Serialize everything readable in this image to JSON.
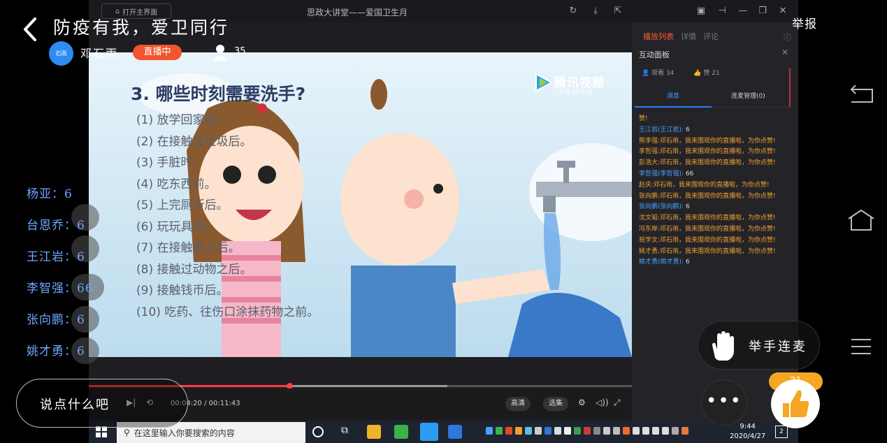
{
  "pc_window": {
    "open_main_label": "打开主界面",
    "title": "思政大讲堂——爱国卫生月"
  },
  "video": {
    "heading": "3. 哪些时刻需要洗手?",
    "list": [
      "(1)  放学回家后。",
      "(2)  在接触过垃圾后。",
      "(3)  手脏时。",
      "(4)  吃东西前。",
      "(5)  上完厕所后。",
      "(6)  玩玩具后。",
      "(7)  在接触他人后。",
      "(8)  接触过动物之后。",
      "(9)  接触钱币后。",
      "(10)  吃药、往伤口涂抹药物之前。"
    ],
    "logo_text": "腾讯视频",
    "logo_sub": "不负好时光"
  },
  "player": {
    "time": "00:04:20 / 00:11:43",
    "progress": 0.37,
    "buffered": 0.66,
    "quality_label": "高清",
    "episodes_label": "选集"
  },
  "panel": {
    "tabs": [
      "播放列表",
      "详情",
      "评论"
    ],
    "active_tab": 0,
    "title": "互动面板",
    "viewers_label": "观看 34",
    "likes_label": "赞 21",
    "subtab_messages": "消息",
    "subtab_link": "连麦管理(0)",
    "chat": [
      {
        "type": "fan",
        "text": "赞!"
      },
      {
        "type": "like",
        "name": "王江岩(王江岩):",
        "value": "6"
      },
      {
        "type": "fan",
        "text": "熊李强:邓石雨，我来围观你的直播啦，为你点赞!"
      },
      {
        "type": "fan",
        "text": "李哲强:邓石雨，我来围观你的直播啦，为你点赞!"
      },
      {
        "type": "fan",
        "text": "彭浩大:邓石雨，我来围观你的直播啦，为你点赞!"
      },
      {
        "type": "like",
        "name": "李哲强(李哲强):",
        "value": "66"
      },
      {
        "type": "fan",
        "text": "赵庆:邓石雨，我来围观你的直播啦，为你点赞!"
      },
      {
        "type": "fan",
        "text": "张向鹏:邓石雨，我来围观你的直播啦，为你点赞!"
      },
      {
        "type": "like",
        "name": "张向鹏(张向鹏):",
        "value": "6"
      },
      {
        "type": "fan",
        "text": "沈文韬:邓石雨，我来围观你的直播啦，为你点赞!"
      },
      {
        "type": "fan",
        "text": "冯东岸:邓石雨，我来围观你的直播啦，为你点赞!"
      },
      {
        "type": "fan",
        "text": "祝学文:邓石雨，我来围观你的直播啦，为你点赞!"
      },
      {
        "type": "fan",
        "text": "姚才勇:邓石雨，我来围观你的直播啦，为你点赞!"
      },
      {
        "type": "like",
        "name": "姚才勇(姚才勇):",
        "value": "6"
      }
    ]
  },
  "taskbar": {
    "search_placeholder": "在这里输入你要搜索的内容",
    "time": "9:44",
    "date": "2020/4/27",
    "notification_count": "2"
  },
  "live": {
    "title": "防疫有我，爱卫同行",
    "report_label": "举报",
    "host_avatar_text": "石雨",
    "host_name": "邓石雨",
    "live_badge": "直播中",
    "viewer_count": "35",
    "scores": [
      {
        "name": "杨亚",
        "value": "6"
      },
      {
        "name": "台恩乔",
        "value": "6"
      },
      {
        "name": "王江岩",
        "value": "6"
      },
      {
        "name": "李智强",
        "value": "66"
      },
      {
        "name": "张向鹏",
        "value": "6"
      },
      {
        "name": "姚才勇",
        "value": "6"
      }
    ],
    "comment_placeholder": "说点什么吧",
    "raise_hand_label": "举手连麦",
    "like_count": "21"
  },
  "colors": {
    "accent_orange": "#f2542d",
    "like_yellow": "#f5a623",
    "score_blue": "#6da6ff",
    "link_blue": "#4aa0ff"
  }
}
